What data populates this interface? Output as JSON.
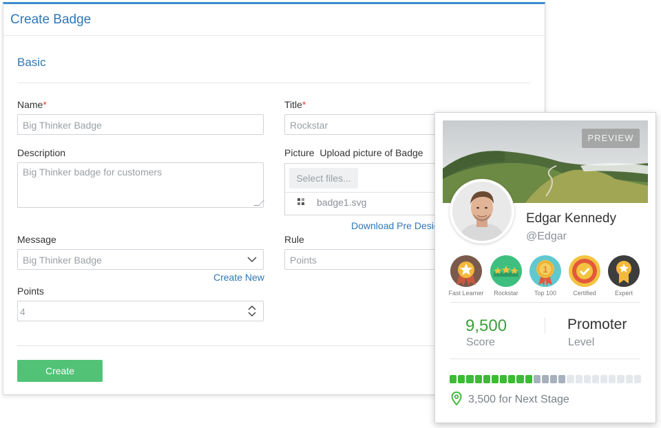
{
  "form": {
    "title": "Create Badge",
    "section": "Basic",
    "fields": {
      "name": {
        "label": "Name",
        "required": "*",
        "placeholder": "Big Thinker Badge"
      },
      "title": {
        "label": "Title",
        "required": "*",
        "placeholder": "Rockstar"
      },
      "description": {
        "label": "Description",
        "placeholder": "Big Thinker badge for customers"
      },
      "picture": {
        "label": "Picture",
        "sublabel": "Upload picture of Badge",
        "select_files": "Select files...",
        "file_name": "badge1.svg",
        "download_link": "Download Pre Desig"
      },
      "message": {
        "label": "Message",
        "placeholder": "Big Thinker Badge",
        "create_new": "Create New"
      },
      "rule": {
        "label": "Rule",
        "placeholder": "Points"
      },
      "points": {
        "label": "Points",
        "value": "4"
      }
    },
    "create_button": "Create"
  },
  "preview": {
    "tag": "PREVIEW",
    "user": {
      "name": "Edgar Kennedy",
      "handle": "@Edgar"
    },
    "badges": [
      {
        "label": "Fast Learner",
        "icon": "star-ribbon-icon",
        "color": "#c8593f"
      },
      {
        "label": "Rockstar",
        "icon": "three-stars-icon",
        "color": "#3fbf7f"
      },
      {
        "label": "Top 100",
        "icon": "medal-one-icon",
        "color": "#5fc9cf"
      },
      {
        "label": "Certified",
        "icon": "certified-check-icon",
        "color": "#e2593a"
      },
      {
        "label": "Expert",
        "icon": "star-medal-icon",
        "color": "#3d3d3d"
      }
    ],
    "score": {
      "value": "9,500",
      "label": "Score"
    },
    "level": {
      "value": "Promoter",
      "label": "Level"
    },
    "progress": {
      "completed_segments": 10,
      "partial_segments": 4,
      "total_segments": 23
    },
    "next_stage": "3,500 for Next Stage"
  },
  "colors": {
    "accent": "#2f77b8",
    "create_button": "#52c276",
    "score": "#3aa13a",
    "progress_done": "#3cbb35",
    "progress_partial": "#a7b0bd",
    "progress_empty": "#e4e8ec",
    "required": "#e0403a"
  }
}
